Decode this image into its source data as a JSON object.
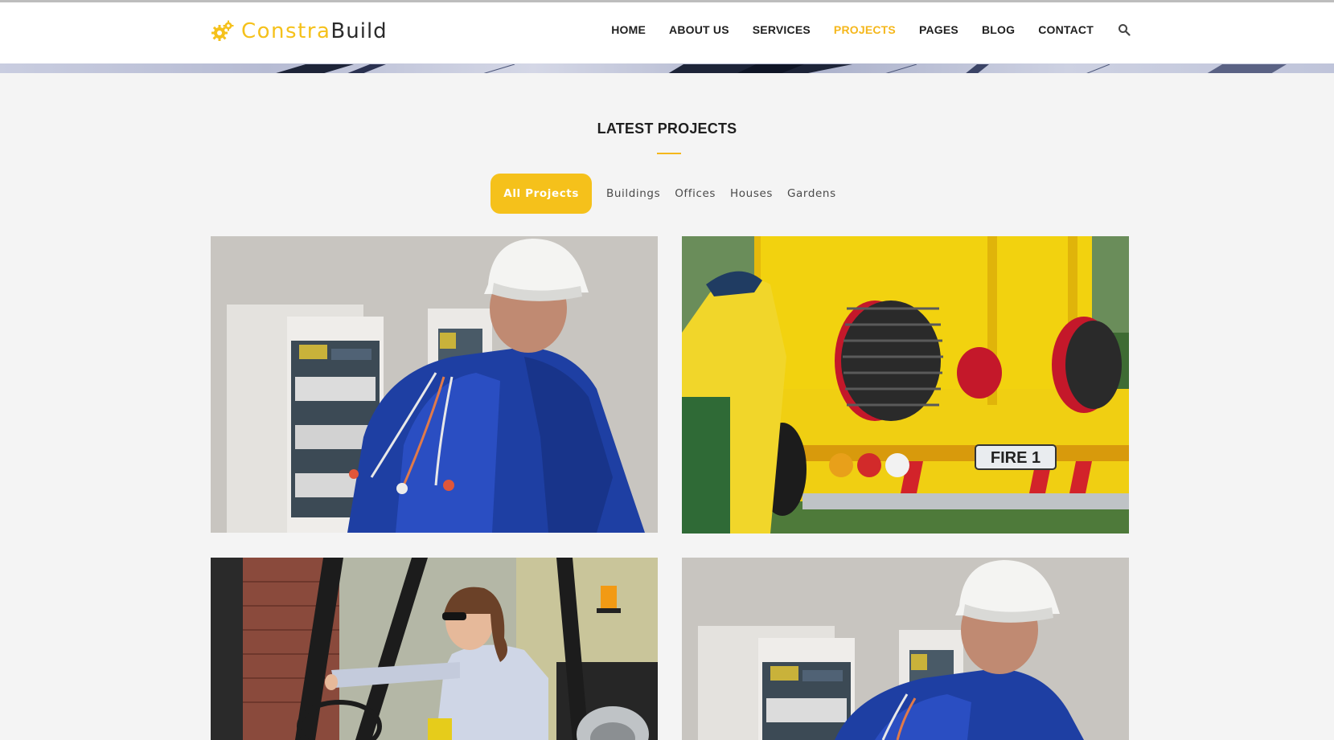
{
  "brand": {
    "name_part1": "Constra",
    "name_part2": "Build",
    "accent_color": "#f5c11b",
    "logo_icon": "gears-icon"
  },
  "nav": {
    "items": [
      {
        "label": "HOME"
      },
      {
        "label": "ABOUT US"
      },
      {
        "label": "SERVICES"
      },
      {
        "label": "PROJECTS",
        "active": true
      },
      {
        "label": "PAGES"
      },
      {
        "label": "BLOG"
      },
      {
        "label": "CONTACT"
      }
    ],
    "search_icon": "search-icon"
  },
  "section": {
    "title": "LATEST PROJECTS"
  },
  "filters": [
    {
      "label": "All Projects",
      "active": true
    },
    {
      "label": "Buildings"
    },
    {
      "label": "Offices"
    },
    {
      "label": "Houses"
    },
    {
      "label": "Gardens"
    }
  ],
  "projects": [
    {
      "image": "electrician-worker-photo"
    },
    {
      "image": "fire-truck-photo",
      "plate_text": "FIRE 1"
    },
    {
      "image": "forklift-operator-photo"
    },
    {
      "image": "electrician-worker-photo"
    }
  ]
}
